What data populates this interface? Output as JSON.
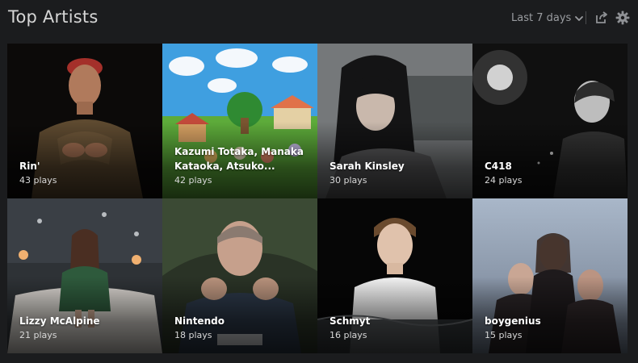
{
  "header": {
    "title": "Top Artists",
    "range_label": "Last 7 days"
  },
  "icons": {
    "range_chevron": "chevron-down-icon",
    "share": "share-icon",
    "settings": "gear-icon"
  },
  "artists": [
    {
      "name": "Rin'",
      "plays": "43 plays"
    },
    {
      "name": "Kazumi Totaka, Manaka Kataoka, Atsuko...",
      "plays": "42 plays"
    },
    {
      "name": "Sarah Kinsley",
      "plays": "30 plays"
    },
    {
      "name": "C418",
      "plays": "24 plays"
    },
    {
      "name": "Lizzy McAlpine",
      "plays": "21 plays"
    },
    {
      "name": "Nintendo",
      "plays": "18 plays"
    },
    {
      "name": "Schmyt",
      "plays": "16 plays"
    },
    {
      "name": "boygenius",
      "plays": "15 plays"
    }
  ]
}
